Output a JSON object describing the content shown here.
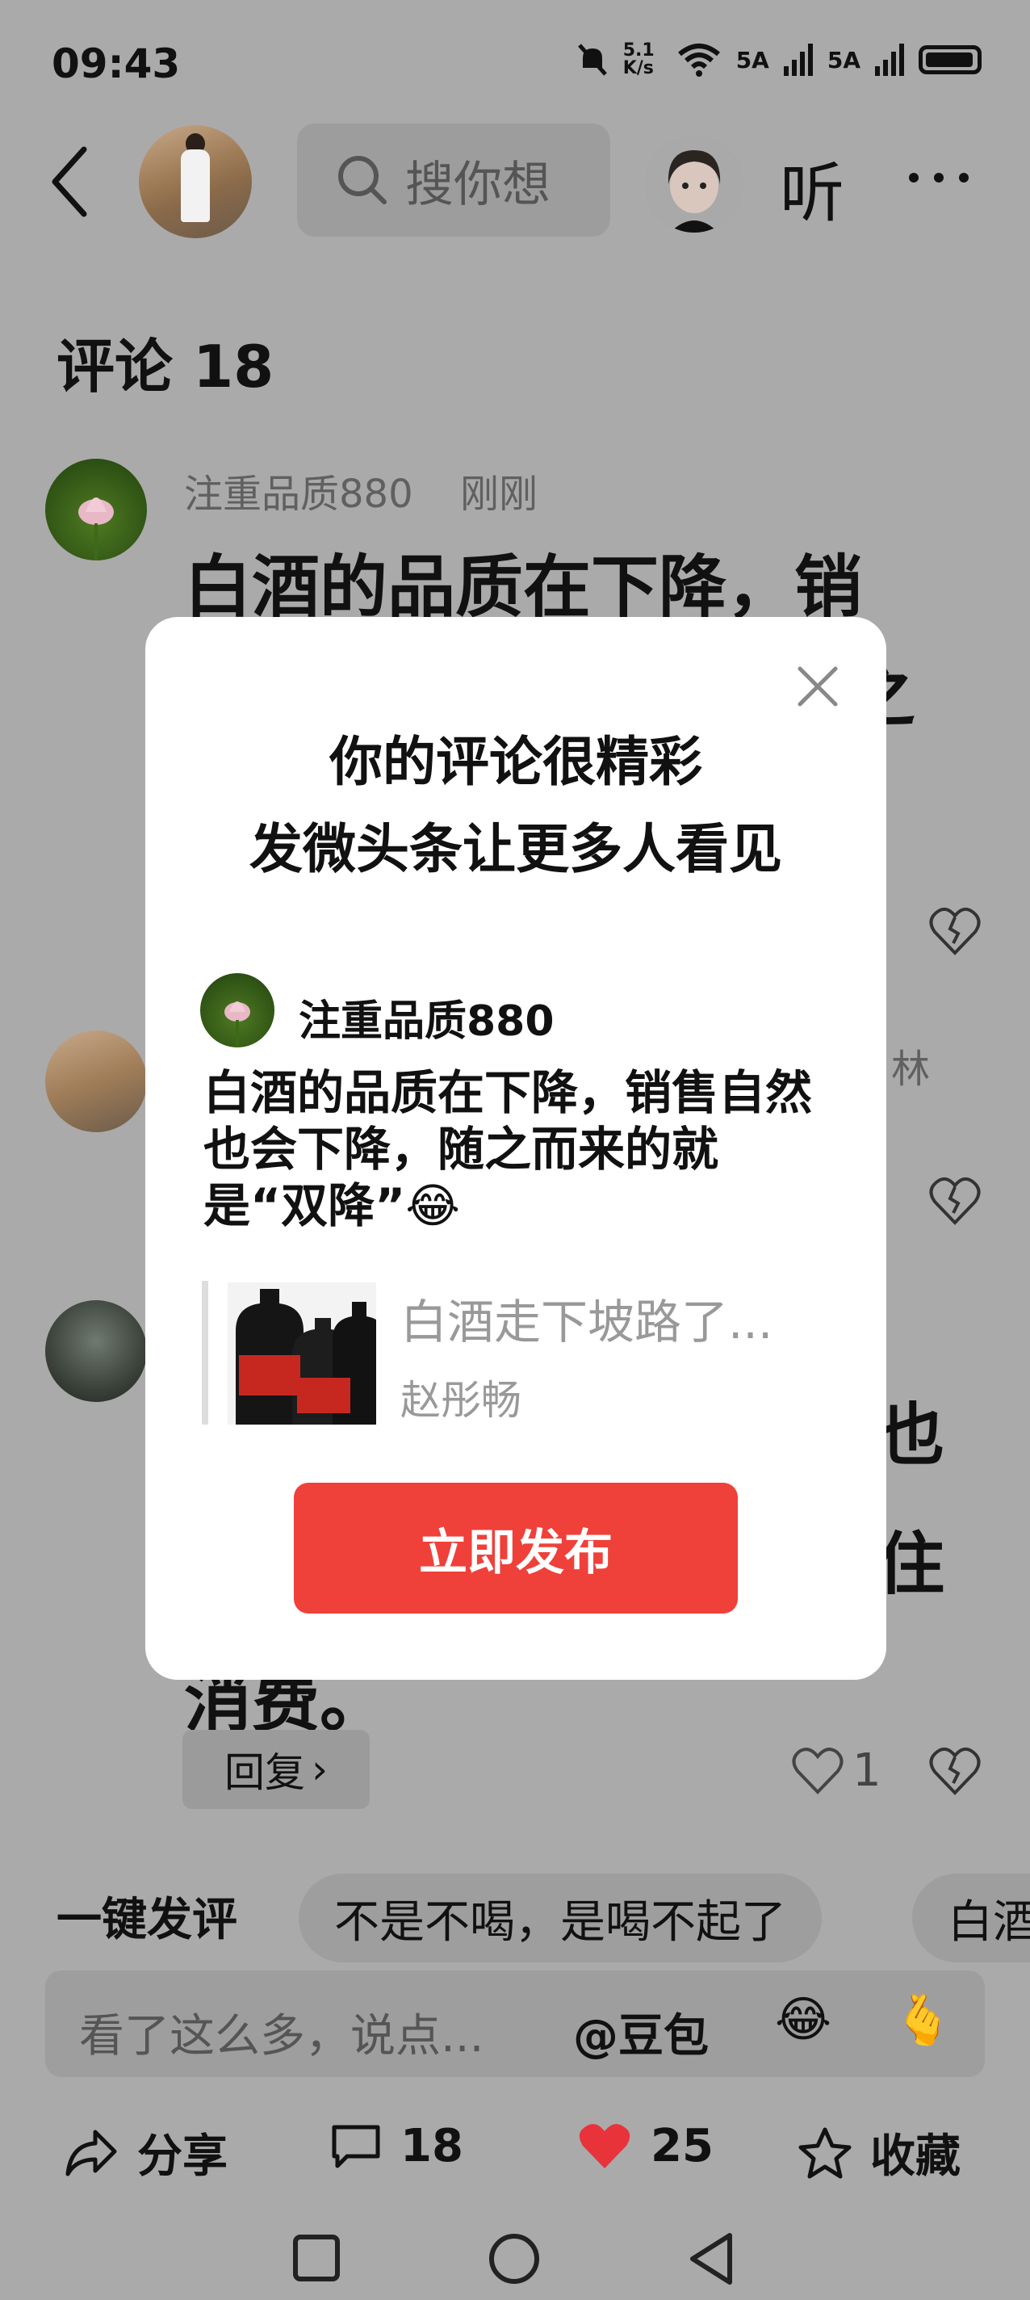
{
  "status_bar": {
    "time": "09:43",
    "net_speed": "5.1 K/s",
    "signal1": "5A",
    "signal2": "5A"
  },
  "topbar": {
    "search_placeholder": "搜你想",
    "listen_label": "听"
  },
  "comments": {
    "title": "评论 18",
    "first": {
      "author": "注重品质880",
      "time": "刚刚",
      "line1": "白酒的品质在下降，销",
      "line2_tail": "之"
    },
    "second": {
      "author_tail": "林"
    },
    "third": {
      "line_tail1": "也",
      "line_tail2": "住",
      "line_last": "消费。"
    },
    "reply_label": "回复",
    "like_count": "1"
  },
  "quick_reply": {
    "label": "一键发评",
    "chips": [
      "不是不喝，是喝不起了",
      "白酒"
    ]
  },
  "input": {
    "placeholder": "看了这么多，说点...",
    "at_label": "@豆包",
    "emoji1": "😂",
    "emoji2": "🫰"
  },
  "bottom_bar": {
    "share": "分享",
    "comments": "18",
    "likes": "25",
    "favorite": "收藏"
  },
  "modal": {
    "title_line1": "你的评论很精彩",
    "title_line2": "发微头条让更多人看见",
    "author": "注重品质880",
    "comment_text": "白酒的品质在下降，销售自然也会下降，随之而来的就是“双降”😂",
    "quote_title": "白酒走下坡路了...",
    "quote_author": "赵彤畅",
    "publish_label": "立即发布"
  },
  "colors": {
    "accent": "#f0403a",
    "heart": "#e8333a",
    "dim_background": "#aaaaaa"
  }
}
